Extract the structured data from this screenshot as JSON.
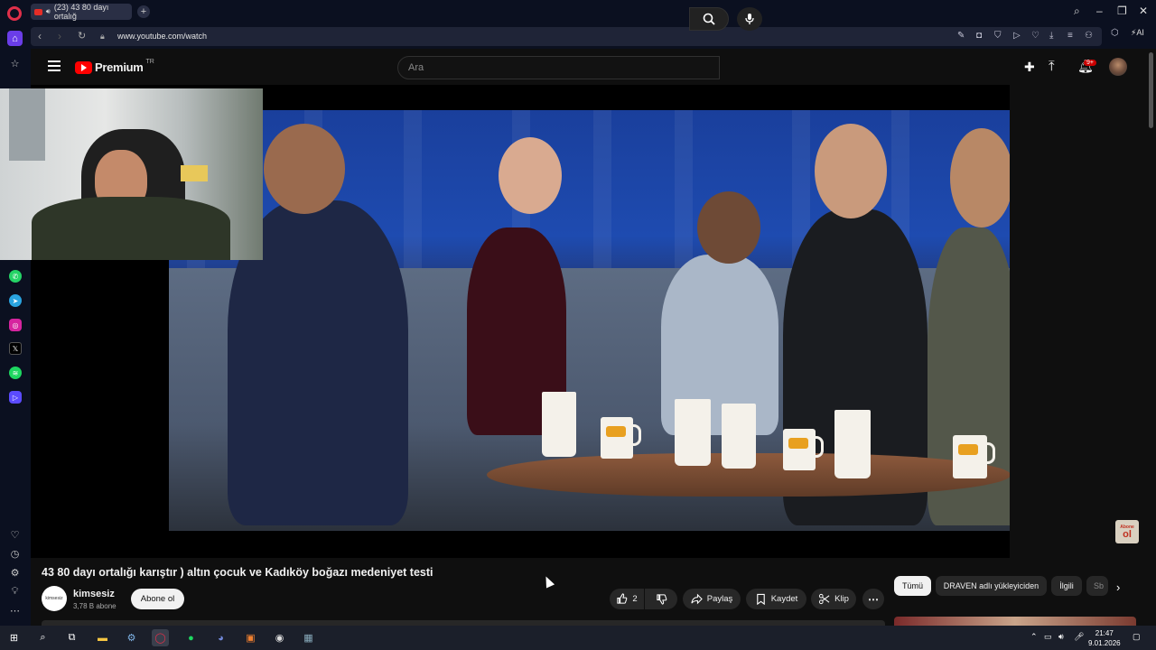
{
  "browser": {
    "tab_title": "(23) 43 80 dayı ortalığ",
    "url": "www.youtube.com/watch",
    "ai_label": "AI"
  },
  "youtube": {
    "brand": "Premium",
    "region": "TR",
    "search_placeholder": "Ara",
    "notifications_badge": "9+"
  },
  "video": {
    "title": "43 80 dayı ortalığı karıştır ) altın çocuk ve Kadıköy boğazı medeniyet testi",
    "channel_name": "kimsesiz",
    "channel_avatar_text": "kimsesiz",
    "subscribers": "3,78 B abone",
    "subscribe_label": "Abone ol",
    "likes": "2",
    "share_label": "Paylaş",
    "save_label": "Kaydet",
    "clip_label": "Klip",
    "overlay_badge_top": "Abone",
    "overlay_badge_bottom": "ol"
  },
  "chips": [
    {
      "label": "Tümü"
    },
    {
      "label": "DRAVEN adlı yükleyiciden"
    },
    {
      "label": "İlgili"
    },
    {
      "label": "Sb"
    }
  ],
  "taskbar": {
    "time": "21:47",
    "date": "9.01.2026"
  },
  "colors": {
    "yt_red": "#ff0000",
    "opera_red": "#e0304a",
    "background": "#0f0f0f"
  }
}
